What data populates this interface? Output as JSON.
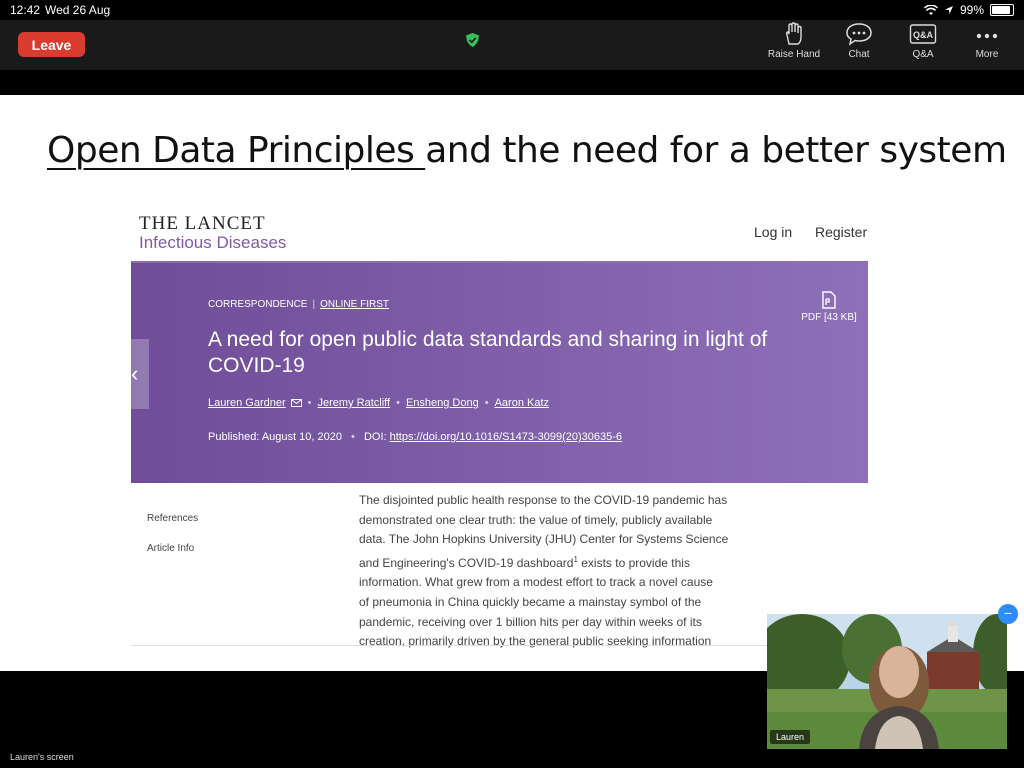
{
  "status_bar": {
    "time": "12:42",
    "date": "Wed 26 Aug",
    "battery": "99%",
    "battery_level": 0.99
  },
  "toolbar": {
    "leave_label": "Leave",
    "tools": [
      {
        "label": "Raise Hand",
        "icon": "raise-hand-icon"
      },
      {
        "label": "Chat",
        "icon": "chat-icon"
      },
      {
        "label": "Q&A",
        "icon": "qa-icon"
      },
      {
        "label": "More",
        "icon": "more-icon"
      }
    ],
    "shield_color": "#35c15c",
    "qa_icon_text": "Q&A"
  },
  "slide": {
    "title_underlined": "Open Data Principles ",
    "title_rest": "and the need for a better system"
  },
  "lancet": {
    "name": "THE LANCET",
    "journal": "Infectious Diseases",
    "login": "Log in",
    "register": "Register",
    "tag_type": "CORRESPONDENCE",
    "tag_status": "ONLINE FIRST",
    "pdf_label": "PDF [43 KB]",
    "article_title": "A need for open public data standards and sharing in light of COVID-19",
    "authors": [
      "Lauren Gardner",
      "Jeremy Ratcliff",
      "Ensheng Dong",
      "Aaron Katz"
    ],
    "published_label": "Published:",
    "published_date": "August 10, 2020",
    "doi_label": "DOI:",
    "doi_link": "https://doi.org/10.1016/S1473-3099(20)30635-6",
    "side_nav": [
      "References",
      "Article Info"
    ],
    "body_lines": [
      "The disjointed public health response to the COVID-19 pandemic has",
      "demonstrated one clear truth: the value of timely, publicly available",
      "data. The John Hopkins University (JHU) Center for Systems Science",
      "and Engineering's COVID-19 dashboard",
      "exists to provide this",
      "information. What grew from a modest effort to track a novel cause",
      "of pneumonia in China quickly became a mainstay symbol of the",
      "pandemic, receiving over 1 billion hits per day within weeks of its",
      "creation, primarily driven by the general public seeking information"
    ],
    "footnote": "1"
  },
  "screen_label": "Lauren's screen",
  "video": {
    "participant": "Lauren",
    "collapse_icon": "−"
  },
  "colors": {
    "leave": "#d93b2f",
    "banner": "#7d5ba6",
    "accent": "#2d8cff"
  }
}
